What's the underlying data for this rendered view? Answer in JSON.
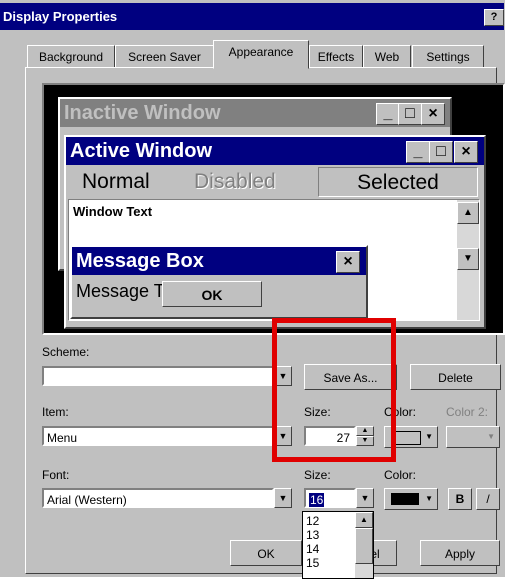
{
  "window": {
    "title": "Display Properties",
    "help_label": "?",
    "close_label": "×"
  },
  "tabs": [
    {
      "label": "Background"
    },
    {
      "label": "Screen Saver"
    },
    {
      "label": "Appearance"
    },
    {
      "label": "Effects"
    },
    {
      "label": "Web"
    },
    {
      "label": "Settings"
    }
  ],
  "preview": {
    "inactive_title": "Inactive Window",
    "active_title": "Active Window",
    "menu_normal": "Normal",
    "menu_disabled": "Disabled",
    "menu_selected": "Selected",
    "window_text": "Window Text",
    "msgbox_title": "Message Box",
    "msgbox_text": "Message Text",
    "ok_label": "OK",
    "min_glyph": "_",
    "max_glyph": "□",
    "close_glyph": "×"
  },
  "scheme": {
    "label": "Scheme:",
    "value": "",
    "save_as": "Save As...",
    "delete": "Delete"
  },
  "item": {
    "label": "Item:",
    "value": "Menu",
    "size_label": "Size:",
    "size_value": "27",
    "color_label": "Color:",
    "color2_label": "Color 2:"
  },
  "font": {
    "label": "Font:",
    "value": "Arial (Western)",
    "size_label": "Size:",
    "size_value": "16",
    "color_label": "Color:",
    "bold_label": "B",
    "italic_label": "/"
  },
  "size_dropdown": {
    "options": [
      "12",
      "13",
      "14",
      "15"
    ]
  },
  "footer": {
    "ok_label": "OK",
    "cancel_label": "Cancel",
    "apply_label": "Apply"
  },
  "colors": {
    "title_active": "#000080",
    "title_inactive": "#808080",
    "selection": "#000080",
    "highlight_box": "#e00000"
  }
}
